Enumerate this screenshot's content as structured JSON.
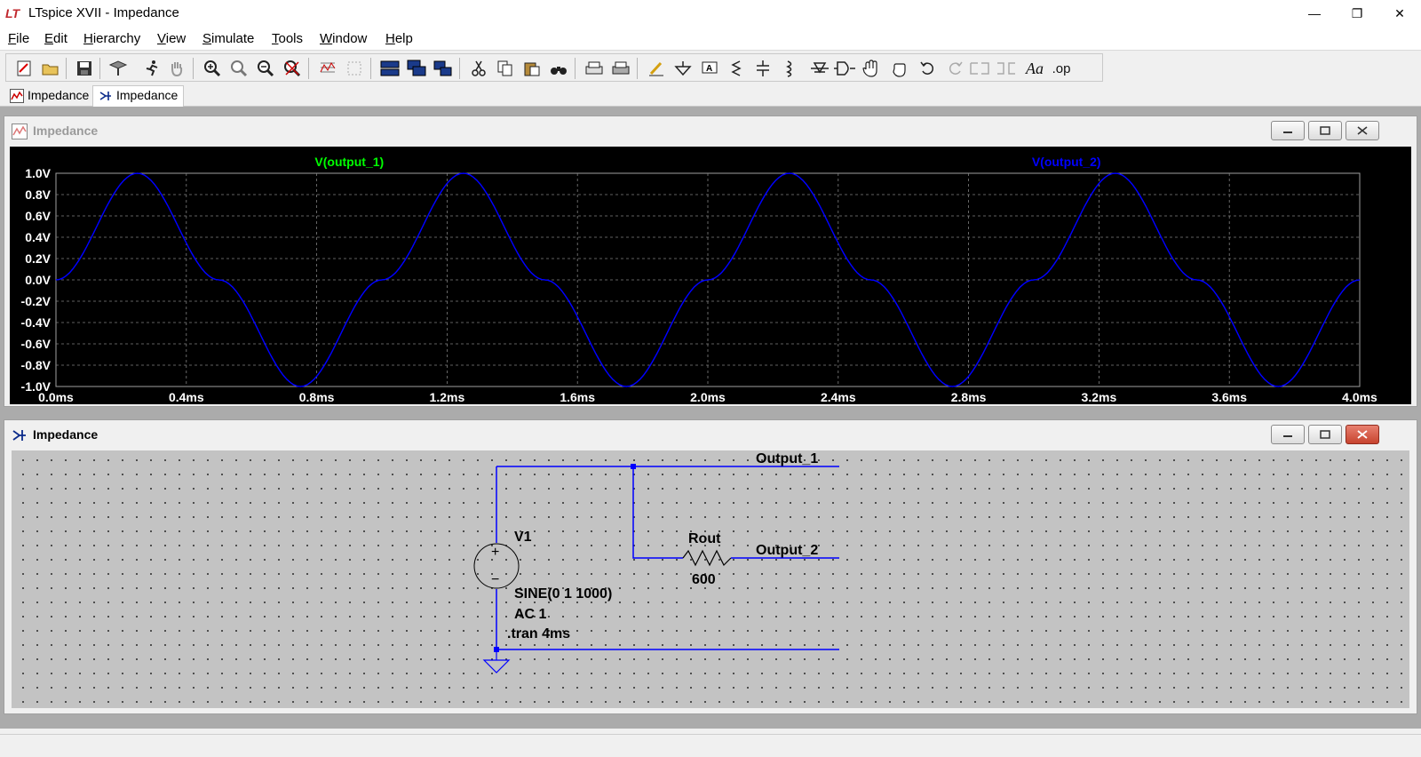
{
  "window": {
    "title": "LTspice XVII - Impedance",
    "minimize_glyph": "—",
    "maximize_glyph": "❐",
    "close_glyph": "✕"
  },
  "menu": [
    {
      "label": "File",
      "key": "F",
      "rest": "ile"
    },
    {
      "label": "Edit",
      "key": "E",
      "rest": "dit"
    },
    {
      "label": "Hierarchy",
      "key": "H",
      "rest": "ierarchy"
    },
    {
      "label": "View",
      "key": "V",
      "rest": "iew"
    },
    {
      "label": "Simulate",
      "key": "S",
      "rest": "imulate"
    },
    {
      "label": "Tools",
      "key": "T",
      "rest": "ools"
    },
    {
      "label": "Window",
      "key": "W",
      "rest": "indow"
    },
    {
      "label": "Help",
      "key": "H",
      "rest": "elp"
    }
  ],
  "toolbar": {
    "icons": [
      "new-schematic-icon",
      "open-icon",
      "save-icon",
      "control-panel-icon",
      "run-icon",
      "halt-icon",
      "zoom-in-icon",
      "zoom-full-icon",
      "zoom-out-icon",
      "zoom-cancel-icon",
      "autorange-icon",
      "fit-icon",
      "tile-horizontal-icon",
      "cascade-icon",
      "tile-vertical-icon",
      "cut-icon",
      "copy-icon",
      "paste-icon",
      "find-icon",
      "print-setup-icon",
      "print-icon",
      "draw-wire-icon",
      "ground-icon",
      "label-net-icon",
      "resistor-icon",
      "capacitor-icon",
      "inductor-icon",
      "diode-icon",
      "component-icon",
      "move-icon",
      "drag-icon",
      "undo-icon",
      "redo-icon",
      "rotate-icon",
      "mirror-icon",
      "text-icon",
      "spice-directive-icon"
    ],
    "text_label": "Aa",
    "op_label": ".op"
  },
  "tabs": [
    {
      "label": "Impedance",
      "icon": "waveform-icon",
      "active": false
    },
    {
      "label": "Impedance",
      "icon": "schematic-icon",
      "active": true
    }
  ],
  "plot_window": {
    "title": "Impedance",
    "traces": [
      {
        "name": "V(output_1)",
        "color": "#00ff00"
      },
      {
        "name": "V(output_2)",
        "color": "#0000ff"
      }
    ]
  },
  "chart_data": {
    "type": "line",
    "title": "",
    "xlabel": "",
    "ylabel": "",
    "xlim": [
      0.0,
      4.0
    ],
    "ylim": [
      -1.0,
      1.0
    ],
    "x_ticks": [
      "0.0ms",
      "0.4ms",
      "0.8ms",
      "1.2ms",
      "1.6ms",
      "2.0ms",
      "2.4ms",
      "2.8ms",
      "3.2ms",
      "3.6ms",
      "4.0ms"
    ],
    "y_ticks": [
      "1.0V",
      "0.8V",
      "0.6V",
      "0.4V",
      "0.2V",
      "0.0V",
      "-0.2V",
      "-0.4V",
      "-0.6V",
      "-0.8V",
      "-1.0V"
    ],
    "grid": true,
    "series": [
      {
        "name": "V(output_1)",
        "x": [
          0.0,
          0.25,
          0.5,
          0.75,
          1.0,
          1.25,
          1.5,
          1.75,
          2.0,
          2.25,
          2.5,
          2.75,
          3.0,
          3.25,
          3.5,
          3.75,
          4.0
        ],
        "values": [
          0.0,
          1.0,
          0.0,
          -1.0,
          0.0,
          1.0,
          0.0,
          -1.0,
          0.0,
          1.0,
          0.0,
          -1.0,
          0.0,
          1.0,
          0.0,
          -1.0,
          0.0
        ]
      },
      {
        "name": "V(output_2)",
        "x": [
          0.0,
          0.25,
          0.5,
          0.75,
          1.0,
          1.25,
          1.5,
          1.75,
          2.0,
          2.25,
          2.5,
          2.75,
          3.0,
          3.25,
          3.5,
          3.75,
          4.0
        ],
        "values": [
          0.0,
          1.0,
          0.0,
          -1.0,
          0.0,
          1.0,
          0.0,
          -1.0,
          0.0,
          1.0,
          0.0,
          -1.0,
          0.0,
          1.0,
          0.0,
          -1.0,
          0.0
        ]
      }
    ],
    "grid_color": "#808080",
    "trace_color": "#0000ff"
  },
  "schematic_window": {
    "title": "Impedance",
    "net_labels": [
      "Output_1",
      "Output_2"
    ],
    "source": {
      "name": "V1",
      "value": "SINE(0 1 1000)",
      "ac": "AC 1",
      "plus": "+",
      "minus": "−"
    },
    "resistor": {
      "name": "Rout",
      "value": "600"
    },
    "directive": ".tran 4ms",
    "wire_color": "#0000ff"
  }
}
